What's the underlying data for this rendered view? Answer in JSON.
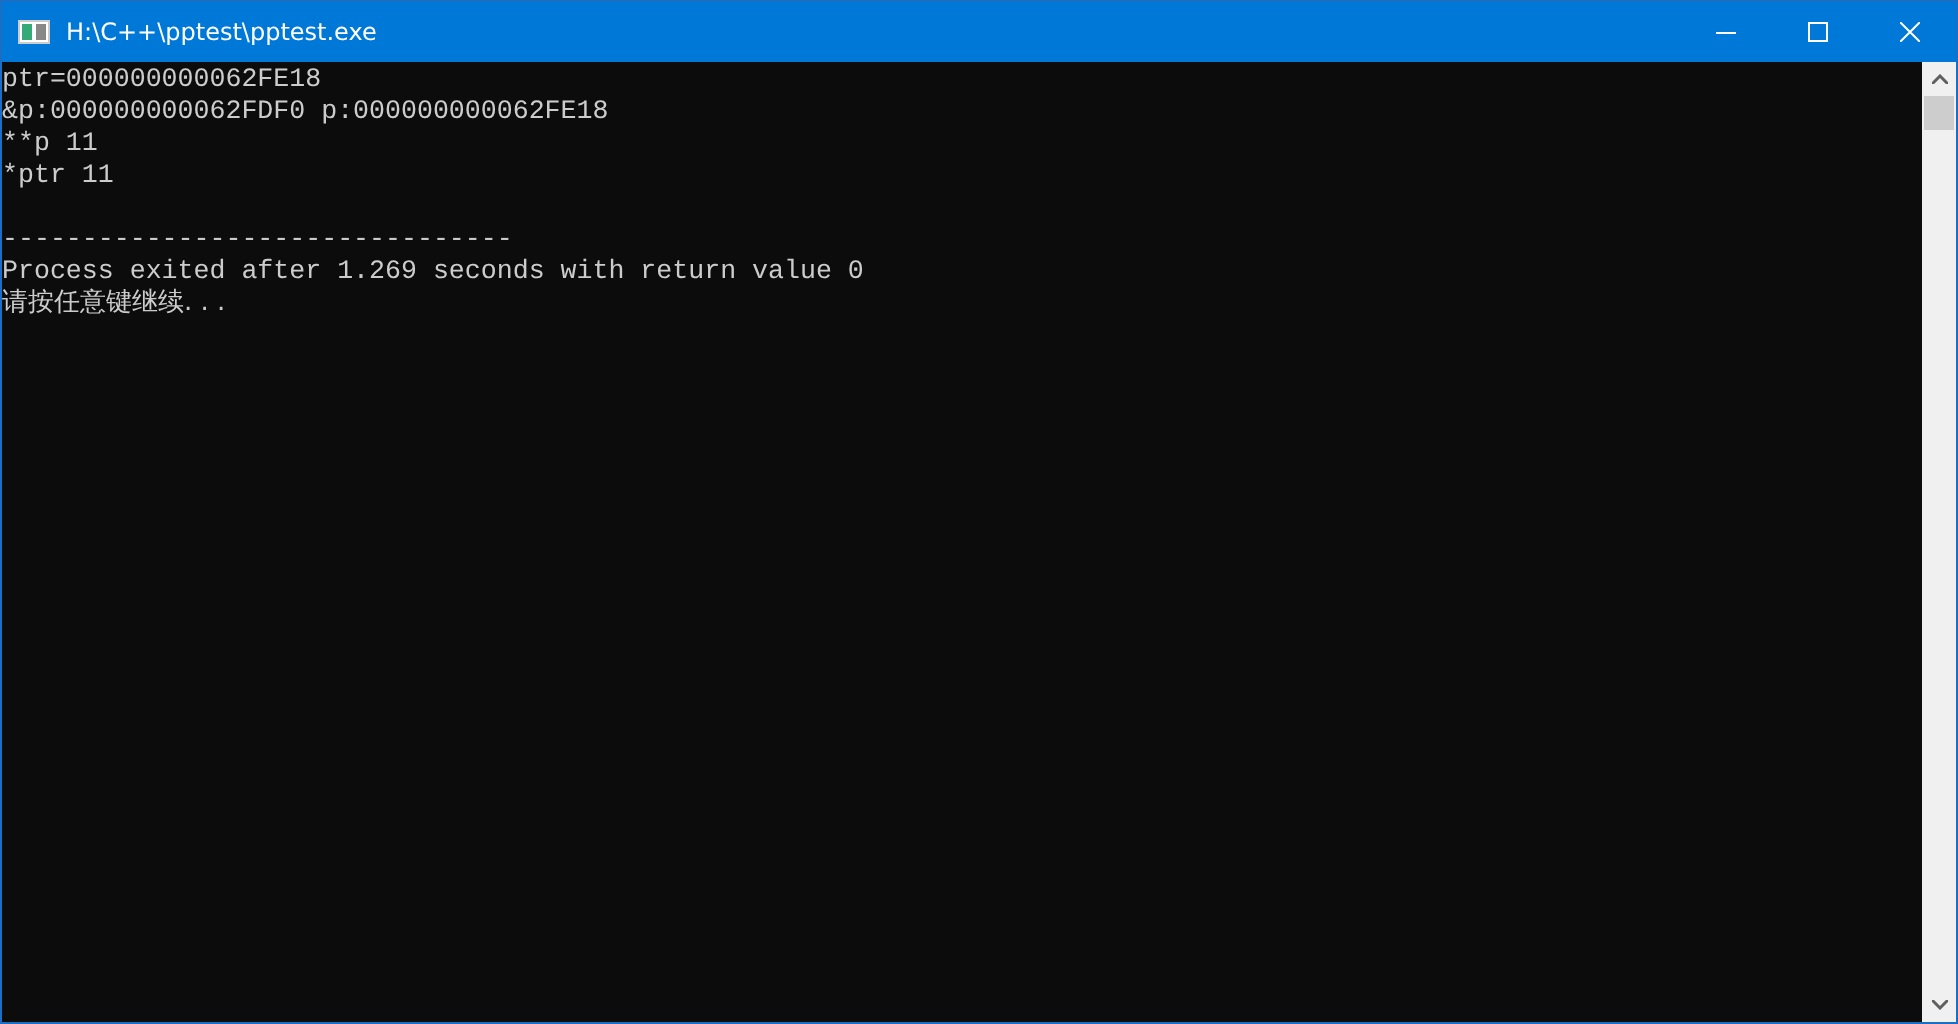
{
  "window": {
    "title": "H:\\C++\\pptest\\pptest.exe"
  },
  "program_output": [
    "ptr=000000000062FE18",
    "&p:000000000062FDF0 p:000000000062FE18",
    "**p 11",
    "*ptr 11"
  ],
  "runner_footer": [
    "--------------------------------",
    "Process exited after 1.269 seconds with return value 0",
    "请按任意键继续. . ."
  ]
}
